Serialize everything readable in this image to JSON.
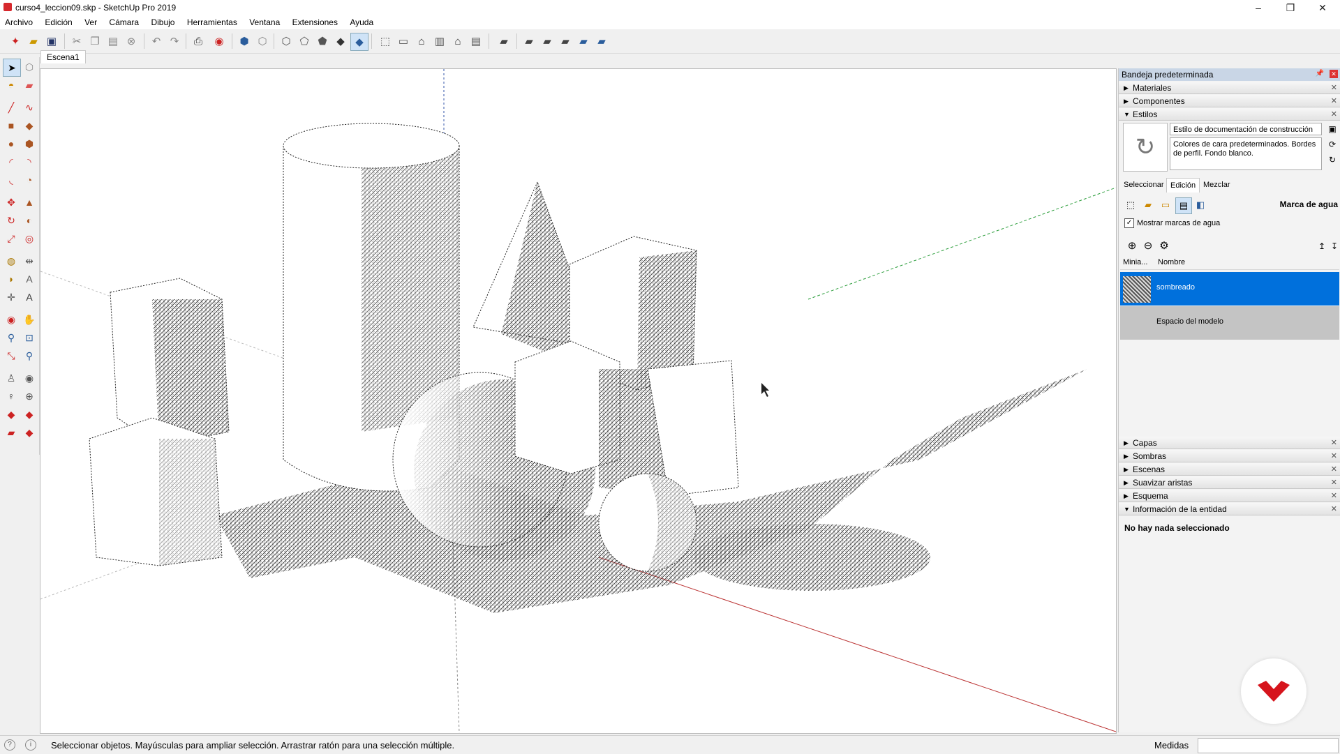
{
  "window": {
    "title": "curso4_leccion09.skp - SketchUp Pro 2019"
  },
  "menu": [
    "Archivo",
    "Edición",
    "Ver",
    "Cámara",
    "Dibujo",
    "Herramientas",
    "Ventana",
    "Extensiones",
    "Ayuda"
  ],
  "scene_tab": "Escena1",
  "tray": {
    "title": "Bandeja predeterminada",
    "panels_top": [
      "Materiales",
      "Componentes",
      "Estilos"
    ],
    "style_name": "Estilo de documentación de construcción",
    "style_desc": "Colores de cara predeterminados. Bordes de perfil. Fondo blanco.",
    "subtabs": [
      "Seleccionar",
      "Edición",
      "Mezclar"
    ],
    "section_title": "Marca de agua",
    "checkbox_label": "Mostrar marcas de agua",
    "list_headers": [
      "Minia...",
      "Nombre"
    ],
    "list_rows": [
      "sombreado",
      "Espacio del modelo"
    ],
    "panels_bottom": [
      "Capas",
      "Sombras",
      "Escenas",
      "Suavizar aristas",
      "Esquema",
      "Información de la entidad"
    ],
    "entity_info": "No hay nada seleccionado"
  },
  "status": {
    "text": "Seleccionar objetos. Mayúsculas para ampliar selección. Arrastrar ratón para una selección múltiple.",
    "measure_label": "Medidas"
  }
}
